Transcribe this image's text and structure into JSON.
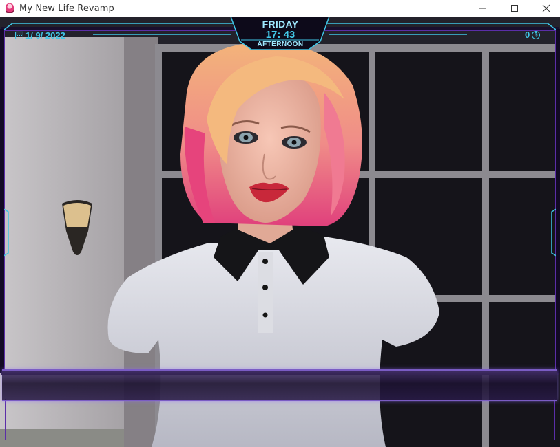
{
  "window": {
    "title": "My New Life Revamp",
    "icon": "app-icon",
    "controls": [
      "minimize-icon",
      "maximize-icon",
      "close-icon"
    ]
  },
  "hud": {
    "date": "1/ 9/ 2022",
    "day": "FRIDAY",
    "time": "17: 43",
    "period": "AFTERNOON",
    "money": "0",
    "currency_symbol": "$",
    "accent_color": "#3fc6e6",
    "frame_color": "#5b2ea8"
  },
  "dialogue": {
    "text": ""
  }
}
